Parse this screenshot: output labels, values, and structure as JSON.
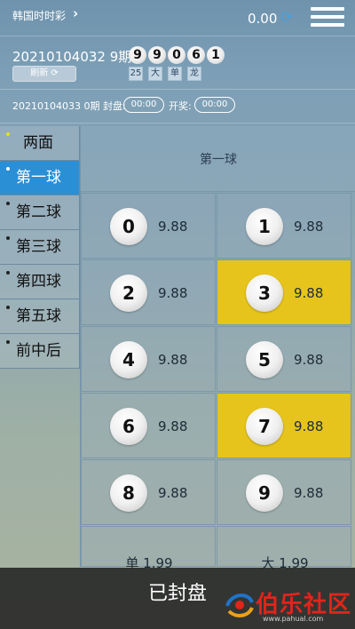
{
  "header": {
    "title": "韩国时时彩",
    "balance": "0.00"
  },
  "current": {
    "issue": "20210104032 9期",
    "numbers": [
      "9",
      "9",
      "0",
      "6",
      "1"
    ],
    "tags": [
      "25",
      "大",
      "单",
      "龙"
    ],
    "refresh_label": "刷新"
  },
  "next": {
    "issue_label": "20210104033 0期 封盘:",
    "close_countdown": "00:00",
    "open_label": "开奖:",
    "open_countdown": "00:00"
  },
  "sidebar": {
    "items": [
      {
        "label": "两面"
      },
      {
        "label": "第一球"
      },
      {
        "label": "第二球"
      },
      {
        "label": "第三球"
      },
      {
        "label": "第四球"
      },
      {
        "label": "第五球"
      },
      {
        "label": "前中后"
      }
    ],
    "active_index": 1
  },
  "panel": {
    "title": "第一球",
    "cells": [
      {
        "number": "0",
        "odds": "9.88"
      },
      {
        "number": "1",
        "odds": "9.88"
      },
      {
        "number": "2",
        "odds": "9.88"
      },
      {
        "number": "3",
        "odds": "9.88"
      },
      {
        "number": "4",
        "odds": "9.88"
      },
      {
        "number": "5",
        "odds": "9.88"
      },
      {
        "number": "6",
        "odds": "9.88"
      },
      {
        "number": "7",
        "odds": "9.88"
      },
      {
        "number": "8",
        "odds": "9.88"
      },
      {
        "number": "9",
        "odds": "9.88"
      }
    ],
    "highlighted": [
      "3",
      "7"
    ],
    "extra": [
      {
        "label": "单 1.99"
      },
      {
        "label": "大 1.99"
      }
    ]
  },
  "status": {
    "sealed_label": "已封盘"
  },
  "watermark": {
    "text": "伯乐社区",
    "url": "www.pahual.com"
  },
  "colors": {
    "active_tab": "#2b8fd6",
    "highlight": "#e6c41b",
    "overlay": "#232323"
  }
}
